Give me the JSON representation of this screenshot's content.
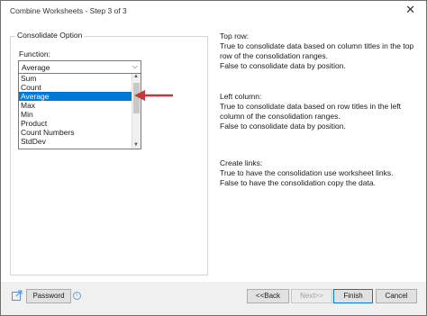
{
  "window": {
    "title": "Combine Worksheets - Step 3 of 3",
    "close_glyph": "✕"
  },
  "consolidate": {
    "group_title": "Consolidate Option",
    "function_label": "Function:",
    "selected": "Average",
    "options": [
      "Sum",
      "Count",
      "Average",
      "Max",
      "Min",
      "Product",
      "Count Numbers",
      "StdDev"
    ]
  },
  "help": {
    "top_row": {
      "heading": "Top row:",
      "lines": [
        "True to consolidate data based on column titles in the top",
        "row of the consolidation ranges.",
        "False to consolidate data by position."
      ]
    },
    "left_column": {
      "heading": "Left column:",
      "lines": [
        "True to consolidate data based on row titles in the left",
        "column of the consolidation ranges.",
        "False to consolidate data by position."
      ]
    },
    "create_links": {
      "heading": "Create links:",
      "lines": [
        "True to have the consolidation use worksheet links.",
        "False to have the consolidation copy the data."
      ]
    }
  },
  "footer": {
    "password": "Password",
    "back": "<<Back",
    "next": "Next>>",
    "finish": "Finish",
    "cancel": "Cancel"
  },
  "colors": {
    "selection": "#0078d7",
    "annotation_arrow": "#c0393b"
  },
  "icons": {
    "share": "share-icon",
    "info": "info-icon",
    "dropdown": "chevron-down-icon"
  }
}
